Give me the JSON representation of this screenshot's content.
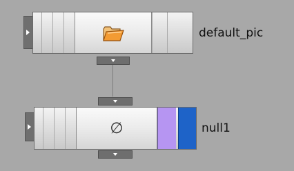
{
  "network": {
    "nodes": [
      {
        "label": "default_pic",
        "icon": "folder-open-icon"
      },
      {
        "label": "null1",
        "icon": "empty-set-icon",
        "icon_glyph": "∅"
      }
    ],
    "flags": {
      "template_color": "#b695f2",
      "display_color": "#1e63c8"
    }
  }
}
